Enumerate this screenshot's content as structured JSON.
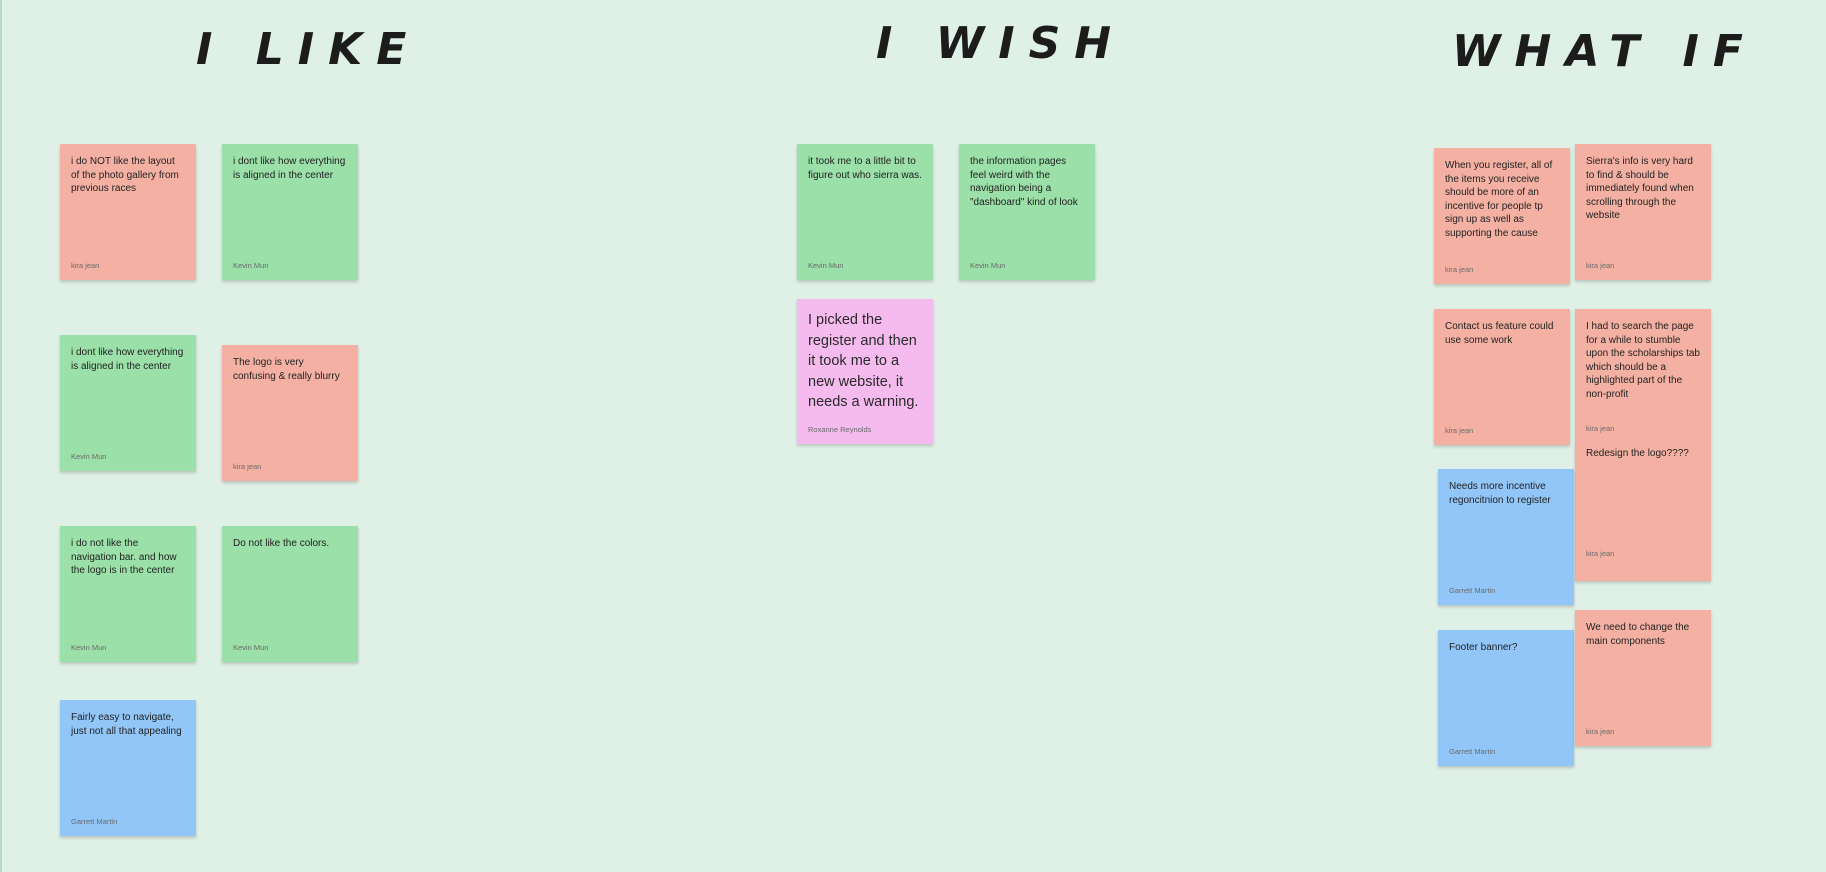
{
  "headings": {
    "like": "I LIKE",
    "wish": "I WISH",
    "whatif": "WHAT IF"
  },
  "colors": {
    "background": "#dff0e6",
    "salmon": "#f4b1a3",
    "green": "#9ae0a8",
    "blue": "#92c6f8",
    "pink": "#f5bbee"
  },
  "notes": {
    "like_1": {
      "text": "i do NOT like the layout of the photo gallery from previous races",
      "author": "kira jean"
    },
    "like_2": {
      "text": "i dont like how everything is aligned in the center",
      "author": "Kevin Mun"
    },
    "like_3": {
      "text": "i dont like how everything is aligned in the center",
      "author": "Kevin Mun"
    },
    "like_4": {
      "text": "The logo is very confusing & really blurry",
      "author": "kira jean"
    },
    "like_5": {
      "text": "i do not like the navigation bar. and how the logo is in the center",
      "author": "Kevin Mun"
    },
    "like_6": {
      "text": "Do not like the colors.",
      "author": "Kevin Mun"
    },
    "like_7": {
      "text": "Fairly easy to navigate, just not all that appealing",
      "author": "Garrett Martin"
    },
    "wish_1": {
      "text": "it took me to a little bit to figure out who sierra was.",
      "author": "Kevin Mun"
    },
    "wish_2": {
      "text": "the information pages feel weird with the navigation being a \"dashboard\" kind of look",
      "author": "Kevin Mun"
    },
    "wish_3": {
      "text": "I picked the register and then it took me to a new website, it needs a warning.",
      "author": "Roxanne Reynolds"
    },
    "whatif_1": {
      "text": "When you register, all of the items you receive should be more of an incentive for people tp sign up as well as supporting the cause",
      "author": "kira jean"
    },
    "whatif_2": {
      "text": "Sierra's info is very hard to find & should be immediately found when scrolling through the website",
      "author": "kira jean"
    },
    "whatif_3": {
      "text": "Contact us feature could use some work",
      "author": "kira jean"
    },
    "whatif_4": {
      "text": "I had to search the page for a while to stumble upon the scholarships tab which should be a highlighted part of the non-profit",
      "author": "kira jean"
    },
    "whatif_5": {
      "text": "Redesign the logo????",
      "author": "kira jean"
    },
    "whatif_6": {
      "text": "Needs more incentive regoncitnion to register",
      "author": "Garrett Martin"
    },
    "whatif_7": {
      "text": "Footer banner?",
      "author": "Garrett Martin"
    },
    "whatif_8": {
      "text": "We need to change the main components",
      "author": "kira jean"
    }
  }
}
